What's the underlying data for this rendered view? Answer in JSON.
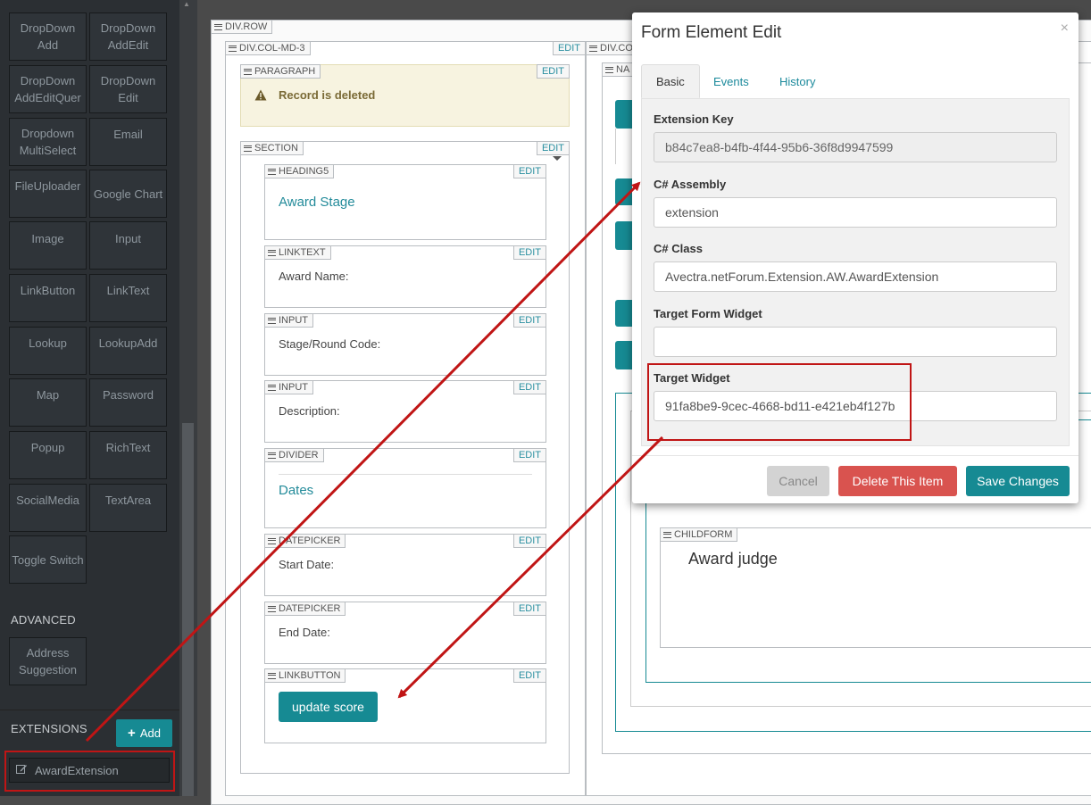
{
  "toolbox": {
    "tiles": [
      {
        "label": "DropDown Add"
      },
      {
        "label": "DropDown AddEdit"
      },
      {
        "label": "DropDown AddEditQuer"
      },
      {
        "label": "DropDown Edit"
      },
      {
        "label": "Dropdown MultiSelect"
      },
      {
        "label": "Email"
      },
      {
        "label": "FileUploader"
      },
      {
        "label": "Google Chart"
      },
      {
        "label": "Image"
      },
      {
        "label": "Input"
      },
      {
        "label": "LinkButton"
      },
      {
        "label": "LinkText"
      },
      {
        "label": "Lookup"
      },
      {
        "label": "LookupAdd"
      },
      {
        "label": "Map"
      },
      {
        "label": "Password"
      },
      {
        "label": "Popup"
      },
      {
        "label": "RichText"
      },
      {
        "label": "SocialMedia"
      },
      {
        "label": "TextArea"
      },
      {
        "label": "Toggle Switch"
      }
    ],
    "advanced_heading": "ADVANCED",
    "advanced_tiles": [
      {
        "label": "Address Suggestion"
      }
    ],
    "extensions_heading": "EXTENSIONS",
    "add_label": "Add",
    "extension_item": "AwardExtension"
  },
  "canvas": {
    "row_label": "DIV.ROW",
    "col_label": "DIV.COL-MD-3",
    "col2_label": "DIV.CO",
    "nav_label": "NA",
    "edit_label": "EDIT",
    "paragraph": {
      "label": "PARAGRAPH",
      "text": "Record is deleted"
    },
    "section_label": "SECTION",
    "heading": {
      "label": "HEADING5",
      "text": "Award Stage"
    },
    "linktext": {
      "label": "LINKTEXT",
      "text": "Award Name:"
    },
    "input1": {
      "label": "INPUT",
      "text": "Stage/Round Code:"
    },
    "input2": {
      "label": "INPUT",
      "text": "Description:"
    },
    "divider": {
      "label": "DIVIDER",
      "text": "Dates"
    },
    "datepicker1": {
      "label": "DATEPICKER",
      "text": "Start Date:"
    },
    "datepicker2": {
      "label": "DATEPICKER",
      "text": "End Date:"
    },
    "linkbutton": {
      "label": "LINKBUTTON",
      "button": "update score"
    },
    "childform": {
      "label": "CHILDFORM",
      "title": "Award judge"
    }
  },
  "modal": {
    "title": "Form Element Edit",
    "close": "×",
    "tabs": [
      "Basic",
      "Events",
      "History"
    ],
    "fields": {
      "extension_key": {
        "label": "Extension Key",
        "value": "b84c7ea8-b4fb-4f44-95b6-36f8d9947599"
      },
      "assembly": {
        "label": "C# Assembly",
        "value": "extension"
      },
      "class": {
        "label": "C# Class",
        "value": "Avectra.netForum.Extension.AW.AwardExtension"
      },
      "target_form_widget": {
        "label": "Target Form Widget",
        "value": ""
      },
      "target_widget": {
        "label": "Target Widget",
        "value": "91fa8be9-9cec-4668-bd11-e421eb4f127b"
      }
    },
    "buttons": {
      "cancel": "Cancel",
      "delete": "Delete This Item",
      "save": "Save Changes"
    }
  },
  "colors": {
    "teal": "#168a93",
    "danger": "#d9534f",
    "annotation_red": "#c01515"
  }
}
